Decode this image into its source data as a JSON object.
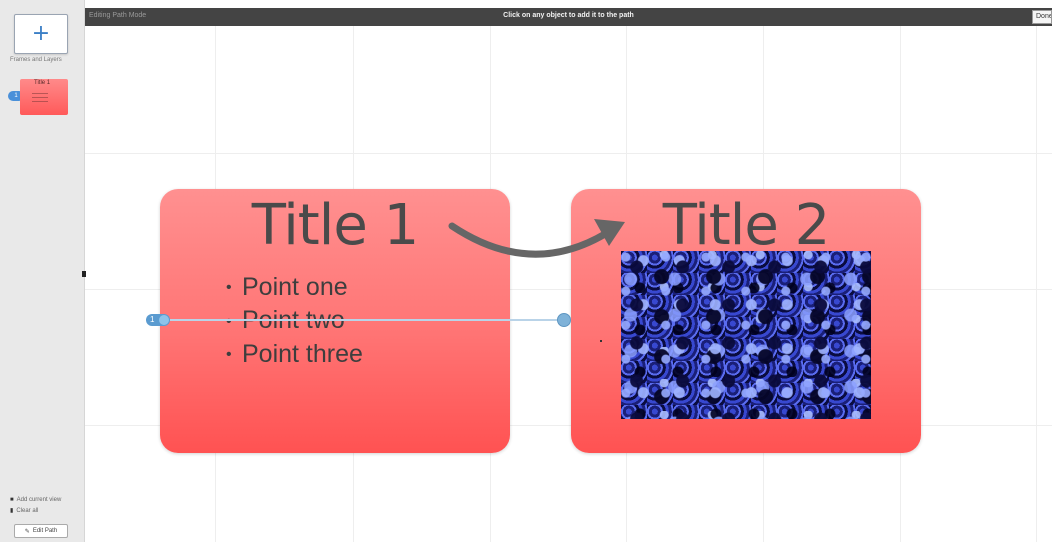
{
  "sidebar": {
    "add_frame_icon": "plus",
    "frames_label": "Frames and Layers",
    "thumbnail": {
      "title": "Title 1",
      "number": "1"
    },
    "bottom_items": [
      {
        "label": "Add current view",
        "icon": "camera-icon"
      },
      {
        "label": "Clear all",
        "icon": "trash-icon"
      }
    ],
    "edit_path_label": "Edit Path"
  },
  "topbar": {
    "title": "Editing Path Mode",
    "message": "Click on any object to add it to the path",
    "done_label": "Done"
  },
  "frames": [
    {
      "title": "Title 1",
      "bullets": [
        "Point one",
        "Point two",
        "Point three"
      ]
    },
    {
      "title": "Title 2",
      "image": "blue textured image"
    }
  ],
  "path": {
    "start_number": "1"
  },
  "colors": {
    "frame_top": "#ff9090",
    "frame_bottom": "#ff5252",
    "path_handle": "#7fb2d8",
    "topbar_bg": "#444444",
    "arrow": "#666666"
  }
}
